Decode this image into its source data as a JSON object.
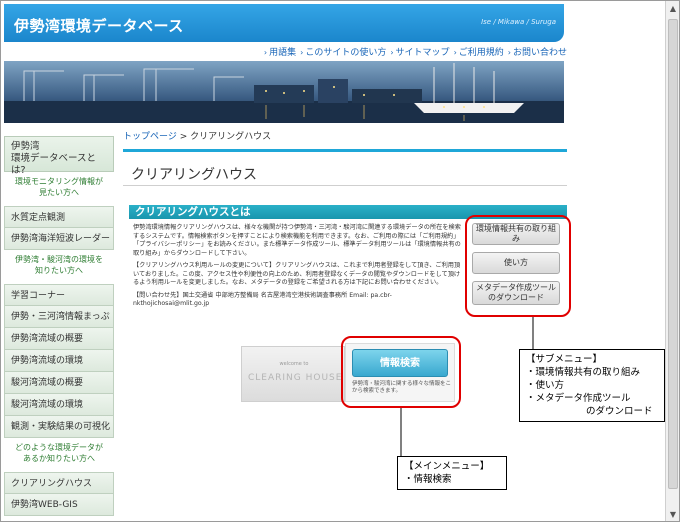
{
  "header": {
    "title": "伊勢湾環境データベース",
    "subtitle": "Ise / Mikawa / Suruga"
  },
  "topnav": {
    "items": [
      "用語集",
      "このサイトの使い方",
      "サイトマップ",
      "ご利用規約",
      "お問い合わせ"
    ]
  },
  "sidebar": {
    "intro": "伊勢湾\n環境データベースとは?",
    "note1": "環境モニタリング情報が\n見たい方へ",
    "group1": [
      "水質定点観測",
      "伊勢湾海洋短波レーダー"
    ],
    "note2": "伊勢湾・駿河湾の環境を\n知りたい方へ",
    "group2": [
      "学習コーナー",
      "伊勢・三河湾情報まっぷ",
      "伊勢湾流域の概要",
      "伊勢湾流域の環境",
      "駿河湾流域の概要",
      "駿河湾流域の環境",
      "観測・実験結果の可視化"
    ],
    "note3": "どのような環境データが\nあるか知りたい方へ",
    "group3": [
      "クリアリングハウス",
      "伊勢湾WEB-GIS"
    ]
  },
  "main": {
    "breadcrumb_home": "トップページ",
    "breadcrumb_sep": " > ",
    "breadcrumb_current": "クリアリングハウス",
    "page_title": "クリアリングハウス",
    "section_title": "クリアリングハウスとは",
    "para1": "伊勢湾環境情報クリアリングハウスは、様々な機関が持つ伊勢湾・三河湾・駿河湾に関連する環境データの所在を検索するシステムです。情報検索ボタンを押すことにより検索機能を利用できます。なお、ご利用の際には「ご利用規約」「プライバシーポリシー」をお読みください。また標準データ作成ツール、標準データ利用ツールは「環境情報共有の取り組み」からダウンロードして下さい。",
    "para2": "【クリアリングハウス利用ルールの変更について】クリアリングハウスは、これまで利用者登録をして頂き、ご利用頂いておりました。この度、アクセス性や利便性の向上のため、利用者登録なくデータの閲覧やダウンロードをして頂けるよう利用ルールを変更しました。なお、メタデータの登録をご希望される方は下記にお問い合わせください。",
    "para3": "【問い合わせ先】国土交通省 中部地方整備局 名古屋港湾空港技術調査事務所 Email: pa.cbr-nkthojichosai@mlit.go.jp",
    "sub_buttons": [
      "環境情報共有の取り組み",
      "使い方",
      "メタデータ作成ツール\nのダウンロード"
    ],
    "ch_welcome": "welcome to",
    "ch_text": "CLEARING HOUSE",
    "info_button": "情報検索",
    "info_desc": "伊勢湾・駿河湾に関する様々な情報をこから検索できます。"
  },
  "callouts": {
    "sub": {
      "title": "【サブメニュー】",
      "items": [
        "・環境情報共有の取り組み",
        "・使い方",
        "・メタデータ作成ツール"
      ],
      "cont": "のダウンロード"
    },
    "main": {
      "title": "【メインメニュー】",
      "items": [
        "・情報検索"
      ]
    }
  }
}
